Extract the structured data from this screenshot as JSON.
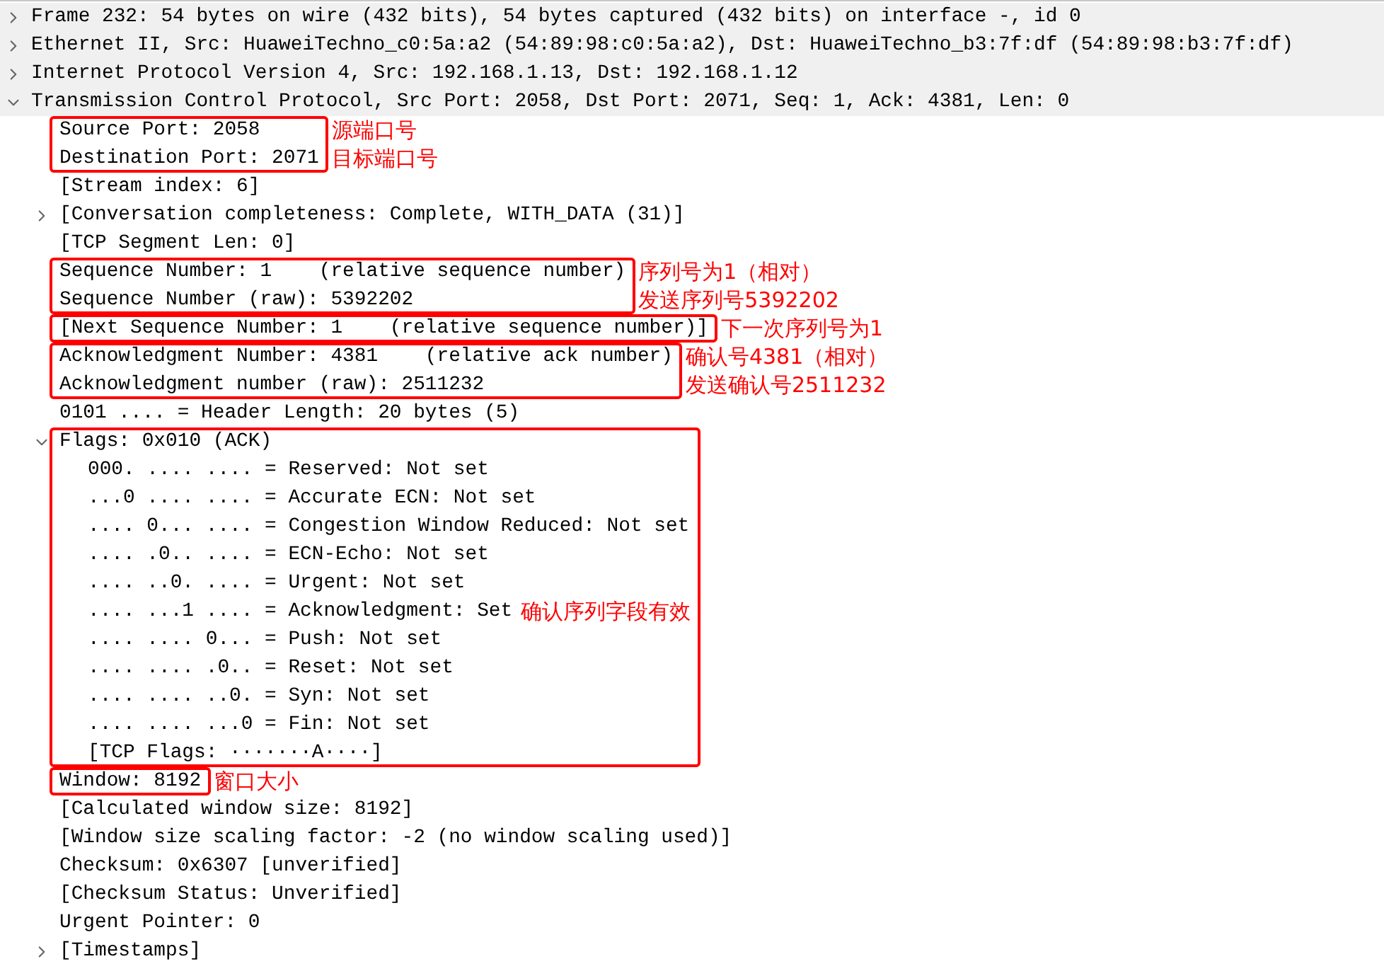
{
  "tree": [
    {
      "text": "Frame 232: 54 bytes on wire (432 bits), 54 bytes captured (432 bits) on interface -, id 0",
      "expanded": false
    },
    {
      "text": "Ethernet II, Src: HuaweiTechno_c0:5a:a2 (54:89:98:c0:5a:a2), Dst: HuaweiTechno_b3:7f:df (54:89:98:b3:7f:df)",
      "expanded": false
    },
    {
      "text": "Internet Protocol Version 4, Src: 192.168.1.13, Dst: 192.168.1.12",
      "expanded": false
    },
    {
      "text": "Transmission Control Protocol, Src Port: 2058, Dst Port: 2071, Seq: 1, Ack: 4381, Len: 0",
      "expanded": true,
      "children": [
        {
          "kind": "highlight",
          "rows": [
            {
              "text": "Source Port: 2058"
            },
            {
              "text": "Destination Port: 2071"
            }
          ],
          "notes": [
            "源端口号",
            "目标端口号"
          ]
        },
        {
          "kind": "field",
          "text": "[Stream index: 6]"
        },
        {
          "kind": "field",
          "text": "[Conversation completeness: Complete, WITH_DATA (31)]",
          "expanded": false
        },
        {
          "kind": "field",
          "text": "[TCP Segment Len: 0]"
        },
        {
          "kind": "highlight",
          "rows": [
            {
              "text": "Sequence Number: 1    (relative sequence number)"
            },
            {
              "text": "Sequence Number (raw): 5392202"
            }
          ],
          "notes": [
            "序列号为1（相对）",
            "发送序列号5392202"
          ]
        },
        {
          "kind": "highlight",
          "rows": [
            {
              "text": "[Next Sequence Number: 1    (relative sequence number)]"
            }
          ],
          "notes": [
            "下一次序列号为1"
          ]
        },
        {
          "kind": "highlight",
          "rows": [
            {
              "text": "Acknowledgment Number: 4381    (relative ack number)"
            },
            {
              "text": "Acknowledgment number (raw): 2511232"
            }
          ],
          "notes": [
            "确认号4381（相对）",
            "发送确认号2511232"
          ]
        },
        {
          "kind": "field",
          "text": "0101 .... = Header Length: 20 bytes (5)"
        },
        {
          "kind": "highlight",
          "rows": [
            {
              "text": "Flags: 0x010 (ACK)",
              "expanded": true,
              "children": [
                {
                  "text": "000. .... .... = Reserved: Not set"
                },
                {
                  "text": "...0 .... .... = Accurate ECN: Not set"
                },
                {
                  "text": ".... 0... .... = Congestion Window Reduced: Not set"
                },
                {
                  "text": ".... .0.. .... = ECN-Echo: Not set"
                },
                {
                  "text": ".... ..0. .... = Urgent: Not set"
                },
                {
                  "text": ".... ...1 .... = Acknowledgment: Set",
                  "note": "确认序列字段有效"
                },
                {
                  "text": ".... .... 0... = Push: Not set"
                },
                {
                  "text": ".... .... .0.. = Reset: Not set"
                },
                {
                  "text": ".... .... ..0. = Syn: Not set"
                },
                {
                  "text": ".... .... ...0 = Fin: Not set"
                },
                {
                  "text": "[TCP Flags: ·······A····]"
                }
              ]
            }
          ]
        },
        {
          "kind": "highlight",
          "rows": [
            {
              "text": "Window: 8192"
            }
          ],
          "notes": [
            "窗口大小"
          ]
        },
        {
          "kind": "field",
          "text": "[Calculated window size: 8192]"
        },
        {
          "kind": "field",
          "text": "[Window size scaling factor: -2 (no window scaling used)]"
        },
        {
          "kind": "field",
          "text": "Checksum: 0x6307 [unverified]"
        },
        {
          "kind": "field",
          "text": "[Checksum Status: Unverified]"
        },
        {
          "kind": "field",
          "text": "Urgent Pointer: 0"
        },
        {
          "kind": "field",
          "text": "[Timestamps]",
          "expanded": false
        }
      ]
    }
  ]
}
